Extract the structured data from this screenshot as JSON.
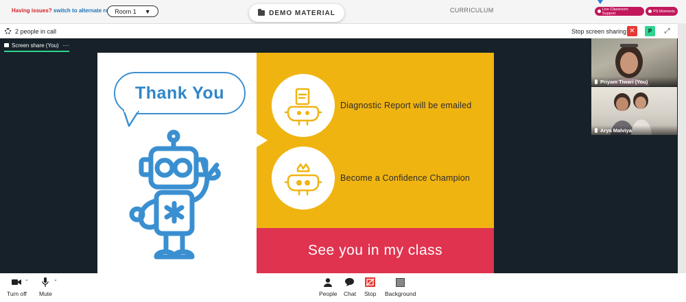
{
  "topbar": {
    "issues_question": "Having issues?",
    "issues_link": "switch to alternate room",
    "room_selected": "Room 1",
    "demo_material_label": "DEMO MATERIAL",
    "curriculum_label": "CURRICULUM",
    "live_support_label": "Live Classroom Support",
    "ps_moments_label": "PS Moments"
  },
  "callbar": {
    "people_count": "2 people in call",
    "stop_sharing_label": "Stop screen sharing",
    "participant_badge": "P"
  },
  "stage": {
    "share_tab_label": "Screen share (You)",
    "slide": {
      "thank_you": "Thank You",
      "item1": "Diagnostic Report will be emailed",
      "item2": "Become a Confidence Champion",
      "footer": "See you in my class"
    },
    "participants": [
      {
        "name": "Priyam Tiwari (You)"
      },
      {
        "name": "Arya Malviya"
      }
    ]
  },
  "toolbar": {
    "turn_off": "Turn off",
    "mute": "Mute",
    "people": "People",
    "chat": "Chat",
    "stop": "Stop",
    "background": "Background"
  },
  "colors": {
    "slide_yellow": "#f0b411",
    "slide_red": "#e0334f",
    "robot_blue": "#3a8fd1",
    "accent_green": "#2fd38f",
    "pill_magenta": "#c2185b"
  }
}
